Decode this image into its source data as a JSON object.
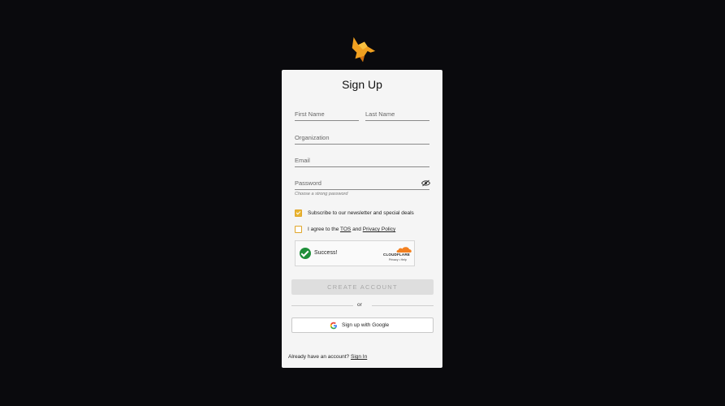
{
  "app": {
    "logo_icon": "fox-logo-icon"
  },
  "form": {
    "title": "Sign Up",
    "first_name_placeholder": "First Name",
    "last_name_placeholder": "Last Name",
    "organization_placeholder": "Organization",
    "email_placeholder": "Email",
    "password_placeholder": "Password",
    "password_hint": "Choose a strong password",
    "password_toggle_icon": "eye-off-icon",
    "newsletter": {
      "label": "Subscribe to our newsletter and special deals",
      "checked": true
    },
    "tos": {
      "prefix": "I agree to the",
      "tos_link": "TOS",
      "and": "and",
      "privacy_link": "Privacy Policy",
      "checked": false
    },
    "captcha": {
      "status": "Success!",
      "brand": "CLOUDFLARE",
      "links": "Privacy • Help"
    },
    "create_button": "CREATE ACCOUNT",
    "or": "or",
    "google_button": "Sign up with Google",
    "already_text": "Already have an account?",
    "sign_in_link": "Sign In"
  },
  "colors": {
    "background": "#0a0a0d",
    "accent": "#e9b531",
    "success": "#1f8f3a",
    "cloudflare": "#f38020"
  }
}
